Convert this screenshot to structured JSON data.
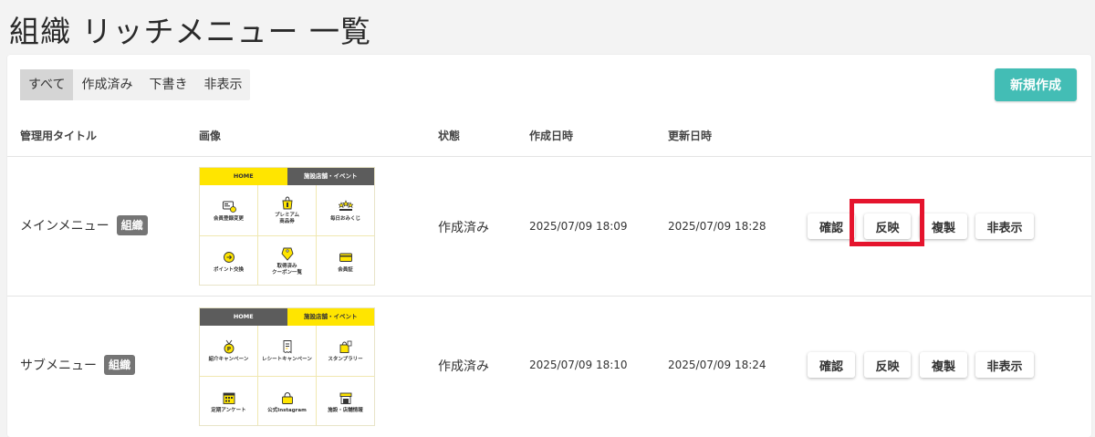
{
  "page": {
    "title": "組織 リッチメニュー 一覧"
  },
  "filters": [
    {
      "label": "すべて",
      "active": true
    },
    {
      "label": "作成済み",
      "active": false
    },
    {
      "label": "下書き",
      "active": false
    },
    {
      "label": "非表示",
      "active": false
    }
  ],
  "new_button_label": "新規作成",
  "columns": {
    "title": "管理用タイトル",
    "image": "画像",
    "status": "状態",
    "created": "作成日時",
    "updated": "更新日時"
  },
  "rows": [
    {
      "title": "メインメニュー",
      "badge": "組織",
      "status": "作成済み",
      "created": "2025/07/09 18:09",
      "updated": "2025/07/09 18:28",
      "actions": {
        "confirm": "確認",
        "apply": "反映",
        "duplicate": "複製",
        "hide": "非表示"
      },
      "thumbnail": {
        "tabs": [
          "HOME",
          "施設店舗・イベント"
        ],
        "active_tab": 0,
        "cells": [
          {
            "label": "会員登録変更",
            "icon": "member-card-icon"
          },
          {
            "label": "プレミアム\n商品券",
            "icon": "gift-bag-icon"
          },
          {
            "label": "毎日おみくじ",
            "icon": "stars-icon"
          },
          {
            "label": "ポイント交換",
            "icon": "coin-exchange-icon"
          },
          {
            "label": "取得済み\nクーポン一覧",
            "icon": "coupon-tag-icon"
          },
          {
            "label": "会員証",
            "icon": "id-card-icon"
          }
        ]
      }
    },
    {
      "title": "サブメニュー",
      "badge": "組織",
      "status": "作成済み",
      "created": "2025/07/09 18:10",
      "updated": "2025/07/09 18:24",
      "actions": {
        "confirm": "確認",
        "apply": "反映",
        "duplicate": "複製",
        "hide": "非表示"
      },
      "thumbnail": {
        "tabs": [
          "HOME",
          "施設店舗・イベント"
        ],
        "active_tab": 1,
        "cells": [
          {
            "label": "紹介キャンペーン",
            "icon": "medal-icon"
          },
          {
            "label": "レシートキャンペーン",
            "icon": "receipt-icon"
          },
          {
            "label": "スタンプラリー",
            "icon": "stamp-bag-icon"
          },
          {
            "label": "定期アンケート",
            "icon": "calendar-icon"
          },
          {
            "label": "公式Instagram",
            "icon": "lock-bag-icon"
          },
          {
            "label": "施設・店舗情報",
            "icon": "shop-icon"
          }
        ]
      }
    }
  ],
  "colors": {
    "accent": "#43bdb5",
    "badge": "#757575",
    "thumbnail_yellow": "#ffe500",
    "highlight": "#e5142d"
  }
}
